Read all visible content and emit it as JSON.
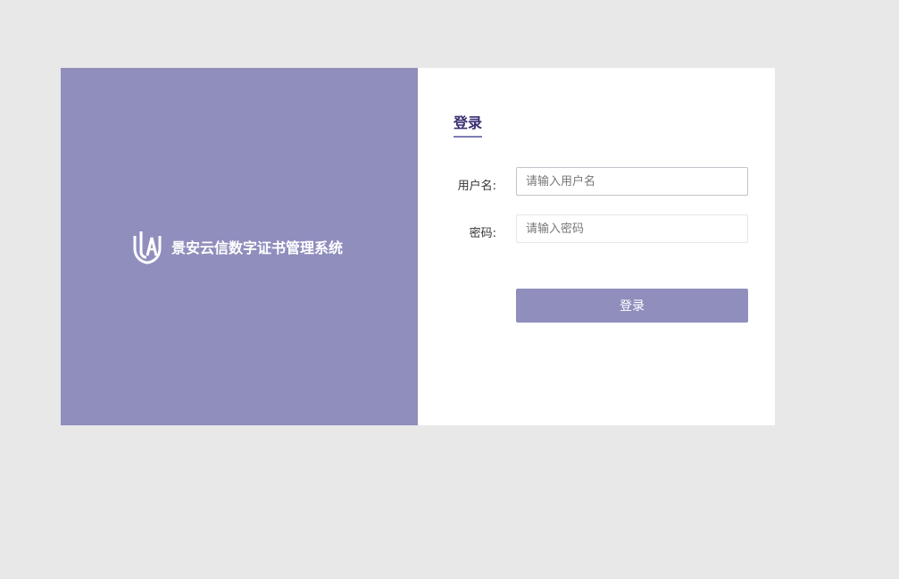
{
  "brand": {
    "logo_icon": "vja-shield-logo",
    "name": "景安云信数字证书管理系统"
  },
  "login": {
    "title": "登录",
    "username_label": "用户名:",
    "username_placeholder": "请输入用户名",
    "username_value": "",
    "password_label": "密码:",
    "password_placeholder": "请输入密码",
    "password_value": "",
    "submit_label": "登录"
  },
  "colors": {
    "page_background": "#e8e8e8",
    "brand_panel": "#908ebd",
    "title_text": "#3b2f73",
    "button": "#908ebd"
  }
}
